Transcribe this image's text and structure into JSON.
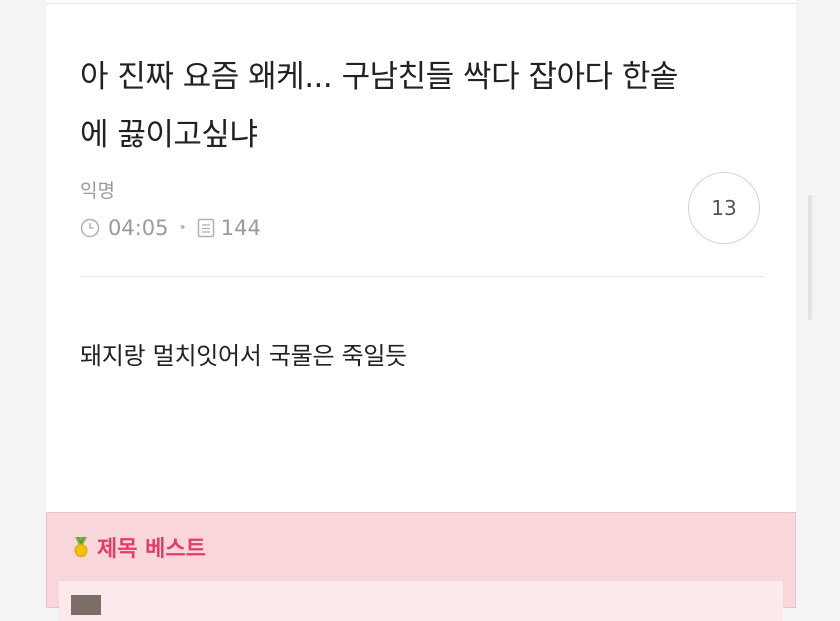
{
  "post": {
    "title_line1": "아 진짜 요즘 왜케... 구남친들 싹다 잡아다 한솥",
    "title_line2": "에 끓이고싶냐",
    "author": "익명",
    "time": "04:05",
    "views": "144",
    "comment_count": "13",
    "body": "돼지랑 멀치잇어서 국물은 죽일듯"
  },
  "best": {
    "title": "제목 베스트"
  },
  "icons": {
    "clock": "clock-icon",
    "views": "document-icon",
    "medal": "medal-icon"
  },
  "colors": {
    "accent": "#e33d6a",
    "best_bg": "#f8d6da",
    "meta_text": "#9a9a9a"
  }
}
